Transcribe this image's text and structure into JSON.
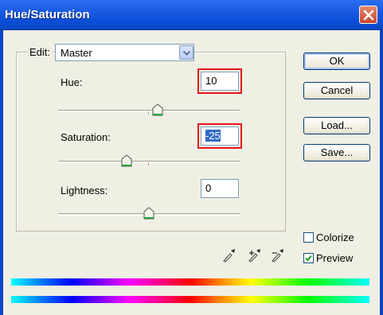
{
  "window": {
    "title": "Hue/Saturation"
  },
  "edit": {
    "label": "Edit:",
    "selected": "Master"
  },
  "hue": {
    "label": "Hue:",
    "value": "10",
    "slider_fraction": 0.55
  },
  "saturation": {
    "label": "Saturation:",
    "value": "-25",
    "slider_fraction": 0.375
  },
  "lightness": {
    "label": "Lightness:",
    "value": "0",
    "slider_fraction": 0.5
  },
  "buttons": {
    "ok": "OK",
    "cancel": "Cancel",
    "load": "Load...",
    "save": "Save..."
  },
  "colorize": {
    "label": "Colorize",
    "checked": false
  },
  "preview": {
    "label": "Preview",
    "checked": true
  },
  "icons": {
    "close": "close-icon",
    "dropdown": "chevron-down-icon",
    "eyedroppers": [
      "eyedropper-icon",
      "eyedropper-plus-icon",
      "eyedropper-minus-icon"
    ]
  },
  "colors": {
    "title_bar": "#0b4fd8",
    "highlight": "#e01818",
    "selection": "#316ac5"
  }
}
